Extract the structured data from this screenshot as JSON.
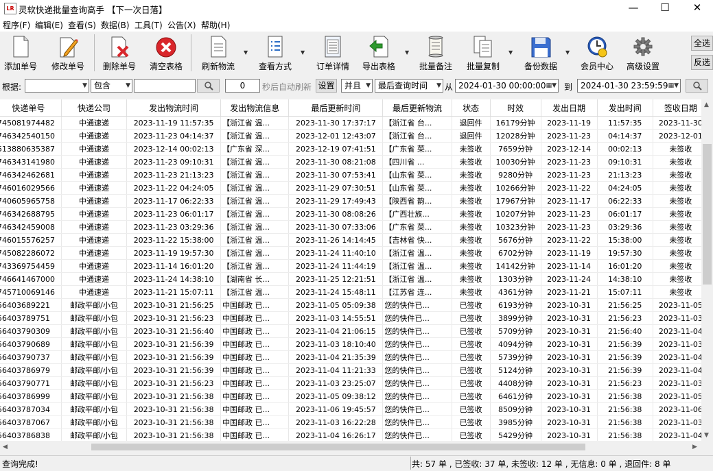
{
  "window": {
    "title": "灵软快递批量查询高手 【下一次日落】",
    "icon_text": "LR",
    "minimize": "—",
    "maximize": "☐",
    "close": "✕"
  },
  "menu": [
    "程序(F)",
    "编辑(E)",
    "查看(S)",
    "数据(B)",
    "工具(T)",
    "公告(X)",
    "帮助(H)"
  ],
  "toolbar": {
    "buttons": [
      {
        "label": "添加单号",
        "icon": "document-icon"
      },
      {
        "label": "修改单号",
        "icon": "edit-pencil-icon"
      },
      {
        "label": "删除单号",
        "icon": "delete-document-icon"
      },
      {
        "label": "清空表格",
        "icon": "clear-red-x-icon"
      },
      {
        "label": "刷新物流",
        "icon": "refresh-document-icon"
      },
      {
        "label": "查看方式",
        "icon": "view-list-icon"
      },
      {
        "label": "订单详情",
        "icon": "order-detail-icon"
      },
      {
        "label": "导出表格",
        "icon": "export-green-arrow-icon"
      },
      {
        "label": "批量备注",
        "icon": "scroll-note-icon"
      },
      {
        "label": "批量复制",
        "icon": "copy-icon"
      },
      {
        "label": "备份数据",
        "icon": "floppy-disk-icon"
      },
      {
        "label": "会员中心",
        "icon": "clock-user-icon"
      },
      {
        "label": "高级设置",
        "icon": "gear-icon"
      }
    ],
    "select_all": "全选",
    "invert": "反选"
  },
  "filter": {
    "label_by": "根据:",
    "field_value": "",
    "match_value": "包含",
    "keyword_value": "",
    "auto_refresh_value": "0",
    "auto_refresh_label": "秒后自动刷新",
    "set_button": "设置",
    "logic_value": "并且",
    "time_field_value": "最后查询时间",
    "from_label": "从",
    "from_value": "2024-01-30 00:00:00",
    "to_label": "到",
    "to_value": "2024-01-30 23:59:59"
  },
  "table": {
    "columns": [
      "快递单号",
      "快递公司",
      "发出物流时间",
      "发出物流信息",
      "最后更新时间",
      "最后更新物流",
      "状态",
      "时效",
      "发出日期",
      "发出时间",
      "签收日期"
    ],
    "rows": [
      [
        "745081974482",
        "中通速递",
        "2023-11-19 11:57:35",
        "【浙江省 温...",
        "2023-11-30 17:37:17",
        "【浙江省 台...",
        "退回件",
        "16179分钟",
        "2023-11-19",
        "11:57:35",
        "2023-11-30"
      ],
      [
        "746342540150",
        "中通速递",
        "2023-11-23 04:14:37",
        "【浙江省 温...",
        "2023-12-01 12:43:07",
        "【浙江省 台...",
        "退回件",
        "12028分钟",
        "2023-11-23",
        "04:14:37",
        "2023-12-01"
      ],
      [
        "513880635387",
        "中通速递",
        "2023-12-14 00:02:13",
        "【广东省 深...",
        "2023-12-19 07:41:51",
        "【广东省 菜...",
        "未签收",
        "7659分钟",
        "2023-12-14",
        "00:02:13",
        "未签收"
      ],
      [
        "746343141980",
        "中通速递",
        "2023-11-23 09:10:31",
        "【浙江省 温...",
        "2023-11-30 08:21:08",
        "【四川省 ...",
        "未签收",
        "10030分钟",
        "2023-11-23",
        "09:10:31",
        "未签收"
      ],
      [
        "746342462681",
        "中通速递",
        "2023-11-23 21:13:23",
        "【浙江省 温...",
        "2023-11-30 07:53:41",
        "【山东省 菜...",
        "未签收",
        "9280分钟",
        "2023-11-23",
        "21:13:23",
        "未签收"
      ],
      [
        "746016029566",
        "中通速递",
        "2023-11-22 04:24:05",
        "【浙江省 温...",
        "2023-11-29 07:30:51",
        "【山东省 菜...",
        "未签收",
        "10266分钟",
        "2023-11-22",
        "04:24:05",
        "未签收"
      ],
      [
        "740605965758",
        "中通速递",
        "2023-11-17 06:22:33",
        "【浙江省 温...",
        "2023-11-29 17:49:43",
        "【陕西省 韵...",
        "未签收",
        "17967分钟",
        "2023-11-17",
        "06:22:33",
        "未签收"
      ],
      [
        "746342688795",
        "中通速递",
        "2023-11-23 06:01:17",
        "【浙江省 温...",
        "2023-11-30 08:08:26",
        "【广西壮族...",
        "未签收",
        "10207分钟",
        "2023-11-23",
        "06:01:17",
        "未签收"
      ],
      [
        "746342459008",
        "中通速递",
        "2023-11-23 03:29:36",
        "【浙江省 温...",
        "2023-11-30 07:33:06",
        "【广东省 菜...",
        "未签收",
        "10323分钟",
        "2023-11-23",
        "03:29:36",
        "未签收"
      ],
      [
        "746015576257",
        "中通速递",
        "2023-11-22 15:38:00",
        "【浙江省 温...",
        "2023-11-26 14:14:45",
        "【吉林省 快...",
        "未签收",
        "5676分钟",
        "2023-11-22",
        "15:38:00",
        "未签收"
      ],
      [
        "745082286072",
        "中通速递",
        "2023-11-19 19:57:30",
        "【浙江省 温...",
        "2023-11-24 11:40:10",
        "【浙江省 温...",
        "未签收",
        "6702分钟",
        "2023-11-19",
        "19:57:30",
        "未签收"
      ],
      [
        "743369754459",
        "中通速递",
        "2023-11-14 16:01:20",
        "【浙江省 温...",
        "2023-11-24 11:44:19",
        "【浙江省 温...",
        "未签收",
        "14142分钟",
        "2023-11-14",
        "16:01:20",
        "未签收"
      ],
      [
        "746641467000",
        "中通速递",
        "2023-11-24 14:38:10",
        "【湖南省 长...",
        "2023-11-25 12:21:51",
        "【浙江省 温...",
        "未签收",
        "1303分钟",
        "2023-11-24",
        "14:38:10",
        "未签收"
      ],
      [
        "745710069146",
        "中通速递",
        "2023-11-21 15:07:11",
        "【浙江省 温...",
        "2023-11-24 15:48:11",
        "【江苏省 连...",
        "未签收",
        "4361分钟",
        "2023-11-21",
        "15:07:11",
        "未签收"
      ],
      [
        "56403689221",
        "邮政平邮/小包",
        "2023-10-31 21:56:25",
        "中国邮政 已...",
        "2023-11-05 05:09:38",
        "您的快件已...",
        "已签收",
        "6193分钟",
        "2023-10-31",
        "21:56:25",
        "2023-11-05"
      ],
      [
        "56403789751",
        "邮政平邮/小包",
        "2023-10-31 21:56:23",
        "中国邮政 已...",
        "2023-11-03 14:55:51",
        "您的快件已...",
        "已签收",
        "3899分钟",
        "2023-10-31",
        "21:56:23",
        "2023-11-03"
      ],
      [
        "56403790309",
        "邮政平邮/小包",
        "2023-10-31 21:56:40",
        "中国邮政 已...",
        "2023-11-04 21:06:15",
        "您的快件已...",
        "已签收",
        "5709分钟",
        "2023-10-31",
        "21:56:40",
        "2023-11-04"
      ],
      [
        "56403790689",
        "邮政平邮/小包",
        "2023-10-31 21:56:39",
        "中国邮政 已...",
        "2023-11-03 18:10:40",
        "您的快件已...",
        "已签收",
        "4094分钟",
        "2023-10-31",
        "21:56:39",
        "2023-11-03"
      ],
      [
        "56403790737",
        "邮政平邮/小包",
        "2023-10-31 21:56:39",
        "中国邮政 已...",
        "2023-11-04 21:35:39",
        "您的快件已...",
        "已签收",
        "5739分钟",
        "2023-10-31",
        "21:56:39",
        "2023-11-04"
      ],
      [
        "56403786979",
        "邮政平邮/小包",
        "2023-10-31 21:56:39",
        "中国邮政 已...",
        "2023-11-04 11:21:33",
        "您的快件已...",
        "已签收",
        "5124分钟",
        "2023-10-31",
        "21:56:39",
        "2023-11-04"
      ],
      [
        "56403790771",
        "邮政平邮/小包",
        "2023-10-31 21:56:23",
        "中国邮政 已...",
        "2023-11-03 23:25:07",
        "您的快件已...",
        "已签收",
        "4408分钟",
        "2023-10-31",
        "21:56:23",
        "2023-11-03"
      ],
      [
        "56403786999",
        "邮政平邮/小包",
        "2023-10-31 21:56:38",
        "中国邮政 已...",
        "2023-11-05 09:38:12",
        "您的快件已...",
        "已签收",
        "6461分钟",
        "2023-10-31",
        "21:56:38",
        "2023-11-05"
      ],
      [
        "56403787034",
        "邮政平邮/小包",
        "2023-10-31 21:56:38",
        "中国邮政 已...",
        "2023-11-06 19:45:57",
        "您的快件已...",
        "已签收",
        "8509分钟",
        "2023-10-31",
        "21:56:38",
        "2023-11-06"
      ],
      [
        "56403787067",
        "邮政平邮/小包",
        "2023-10-31 21:56:38",
        "中国邮政 已...",
        "2023-11-03 16:22:28",
        "您的快件已...",
        "已签收",
        "3985分钟",
        "2023-10-31",
        "21:56:38",
        "2023-11-03"
      ],
      [
        "56403786838",
        "邮政平邮/小包",
        "2023-10-31 21:56:38",
        "中国邮政 已...",
        "2023-11-04 16:26:17",
        "您的快件已...",
        "已签收",
        "5429分钟",
        "2023-10-31",
        "21:56:38",
        "2023-11-04"
      ]
    ]
  },
  "status": {
    "left": "查询完成!",
    "right": "共: 57 单 , 已签收: 37 单, 未签收: 12 单 , 无信息: 0 单 , 退回件: 8 单"
  },
  "colors": {
    "grid_background": "#ffffff",
    "window_background": "#f0f0f0",
    "delete_red": "#d9262b",
    "export_green": "#2e9a2e"
  }
}
